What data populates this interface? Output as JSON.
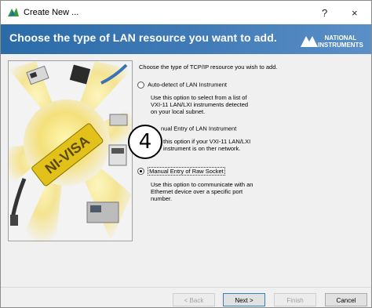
{
  "window": {
    "title": "Create New ...",
    "help_button": "?",
    "close_button": "×",
    "icon": "ni-app-icon"
  },
  "banner": {
    "heading": "Choose the type of LAN resource you want to add.",
    "logo_line1": "NATIONAL",
    "logo_line2": "INSTRUMENTS"
  },
  "illustration": {
    "brand_text": "NI-VISA",
    "description": "illustration"
  },
  "content": {
    "prompt": "Choose the type of TCP/IP resource you wish to add.",
    "options": [
      {
        "label": "Auto-detect of LAN Instrument",
        "description": "Use this option to select from a list of VXI-11 LAN/LXI instruments detected on your local subnet.",
        "selected": false
      },
      {
        "label": "Manual Entry of LAN Instrument",
        "label_visible": "nual Entry of LAN Instrument",
        "description": "Use this option if your VXI-11 LAN/LXI instrument is on another network.",
        "description_visible": "this option if your VXI-11 LAN/LXI instrument is on ther network.",
        "selected": false
      },
      {
        "label": "Manual Entry of Raw Socket",
        "description": "Use this option to communicate with an Ethernet device over a specific port number.",
        "selected": true
      }
    ]
  },
  "callout": {
    "number": "4"
  },
  "footer": {
    "back": "< Back",
    "next": "Next >",
    "finish": "Finish",
    "cancel": "Cancel"
  },
  "colors": {
    "banner": "#3f7ab6",
    "window_bg": "#f0f0f0"
  }
}
